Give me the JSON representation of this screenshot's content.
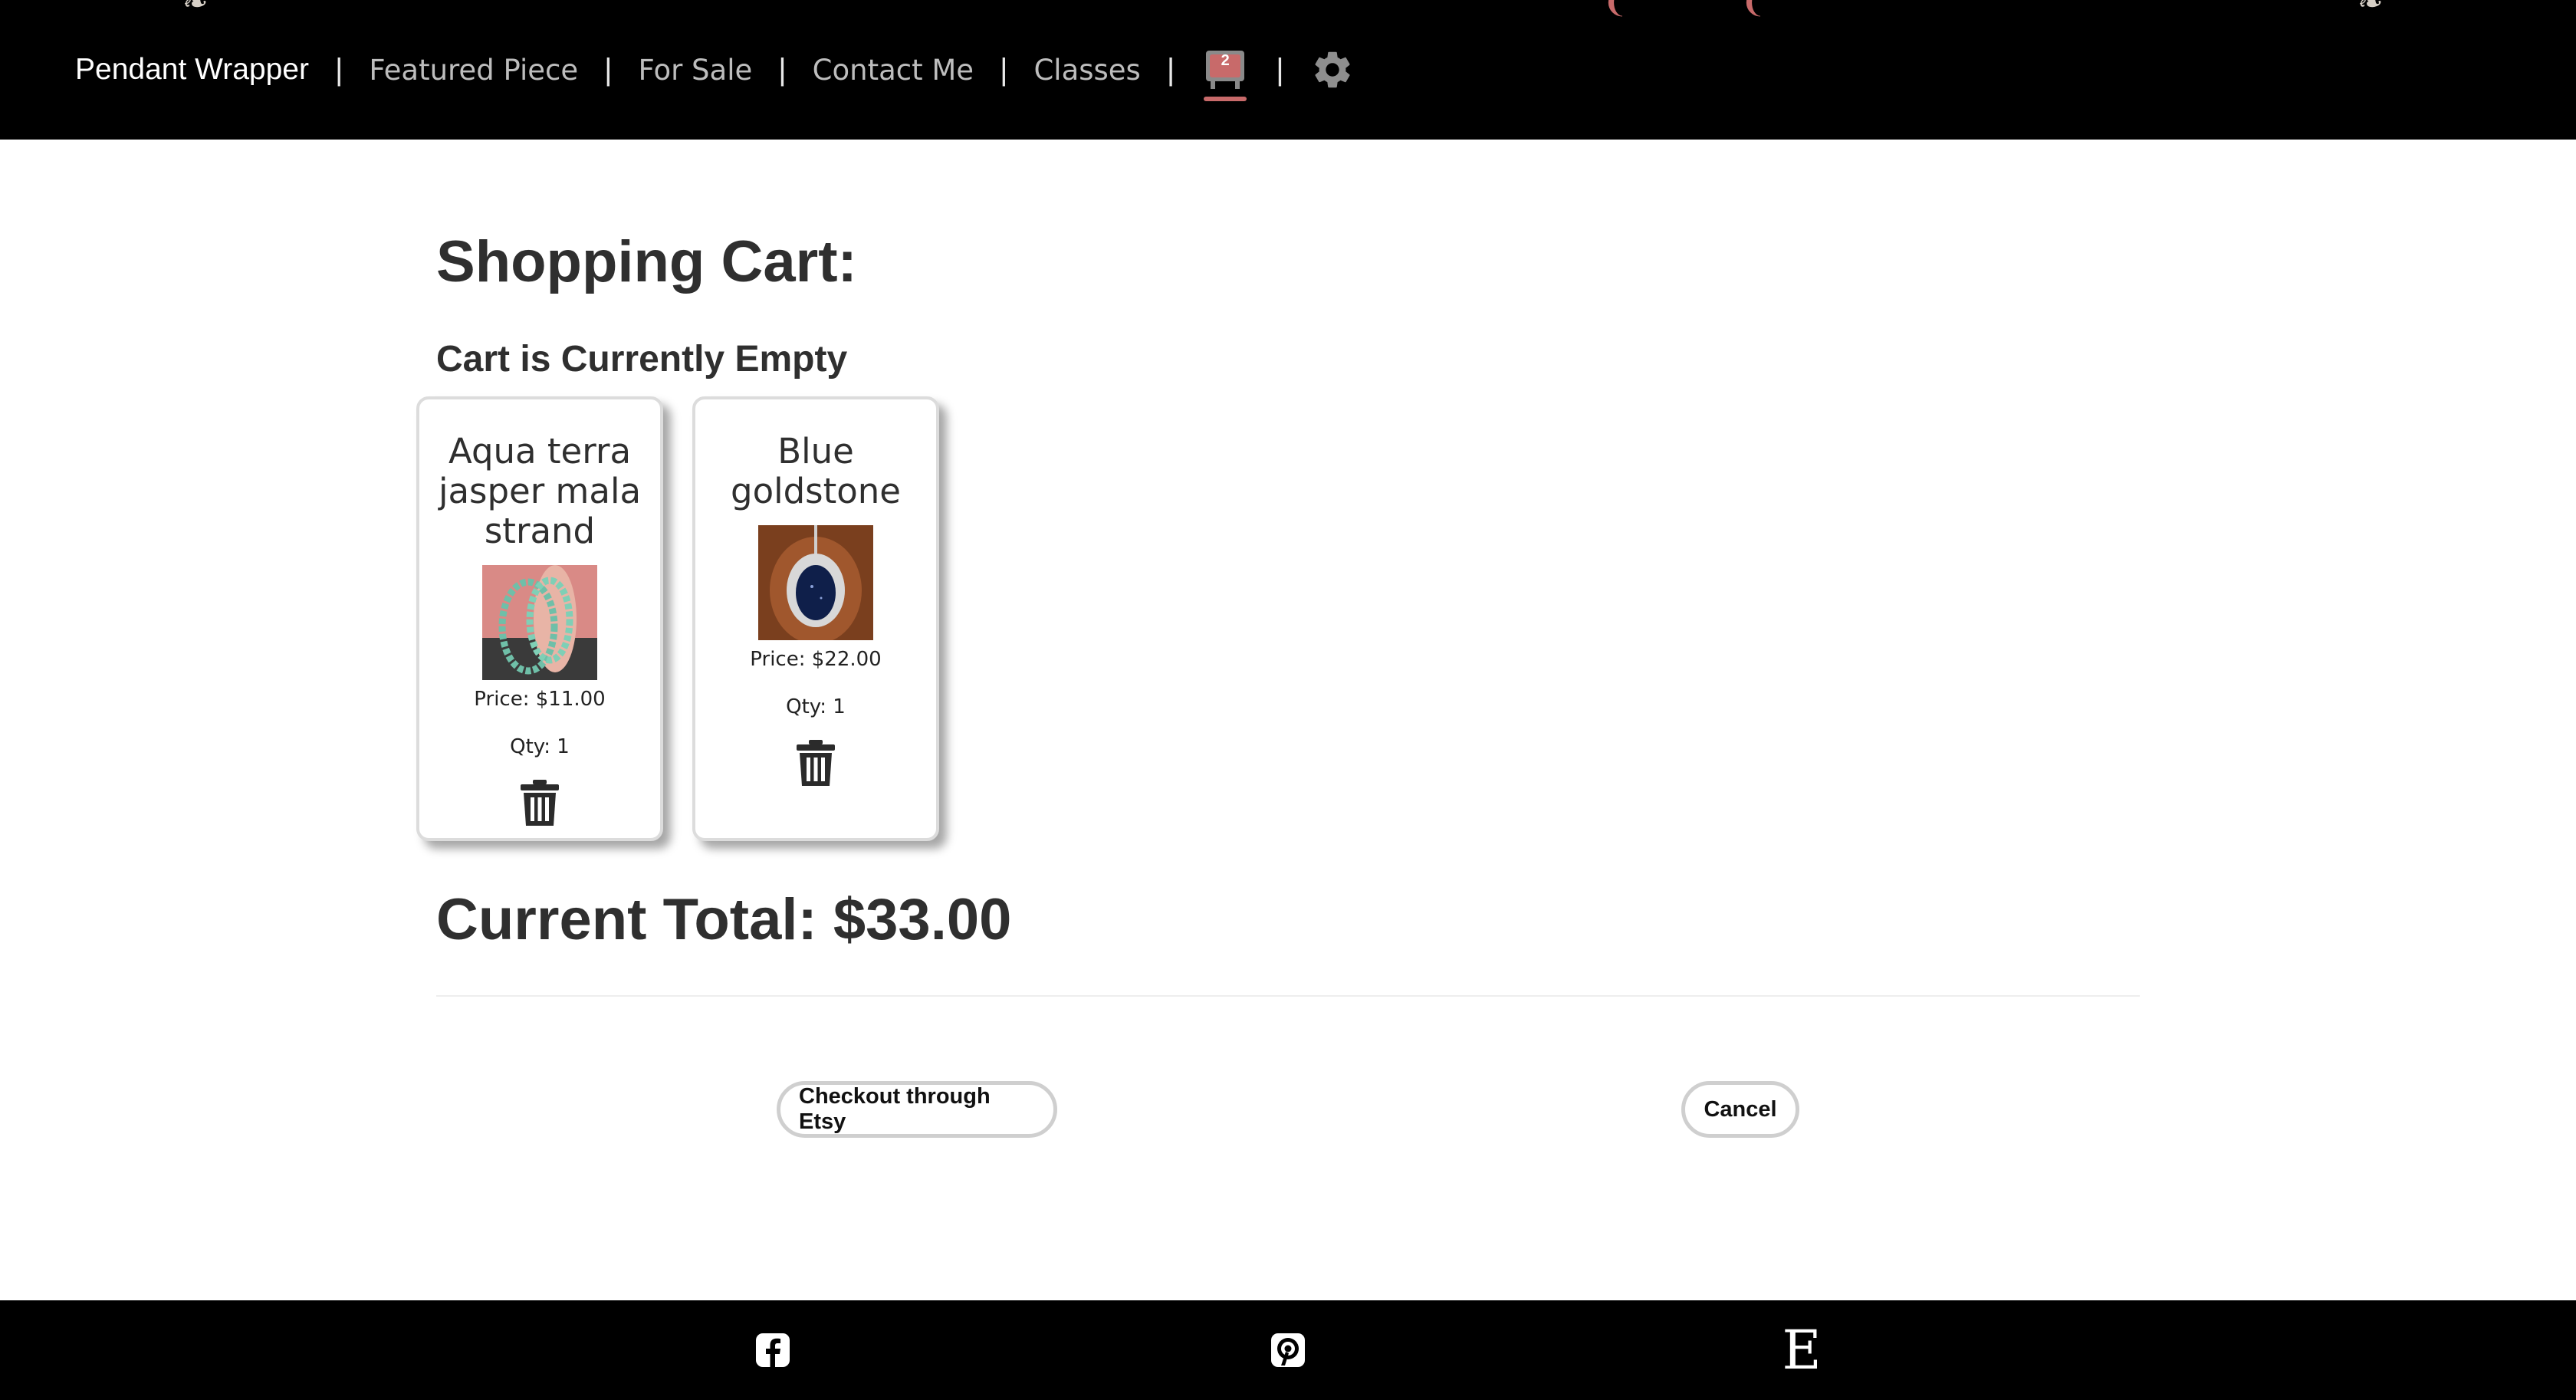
{
  "header": {
    "brand": "Pendant Wrapper",
    "separator": "|",
    "nav_links": [
      "Featured Piece",
      "For Sale",
      "Contact Me",
      "Classes"
    ],
    "cart_count": "2",
    "cart_icon": "shopping-cart-icon",
    "settings_icon": "gear-icon"
  },
  "main": {
    "title": "Shopping Cart:",
    "status": "Cart is Currently Empty",
    "items": [
      {
        "name": "Aqua terra jasper mala strand",
        "price": "Price: $11.00",
        "qty": "Qty: 1",
        "delete_icon": "trash-icon"
      },
      {
        "name": "Blue goldstone",
        "price": "Price: $22.00",
        "qty": "Qty: 1",
        "delete_icon": "trash-icon"
      }
    ],
    "total": "Current Total: $33.00",
    "checkout_label": "Checkout through Etsy",
    "cancel_label": "Cancel"
  },
  "footer": {
    "social": [
      "facebook-icon",
      "pinterest-icon",
      "etsy-icon"
    ],
    "etsy_letter": "E"
  },
  "colors": {
    "header_bg": "#000000",
    "accent": "#c86a6a",
    "text": "#333333",
    "button_border": "#cfcfcf"
  }
}
